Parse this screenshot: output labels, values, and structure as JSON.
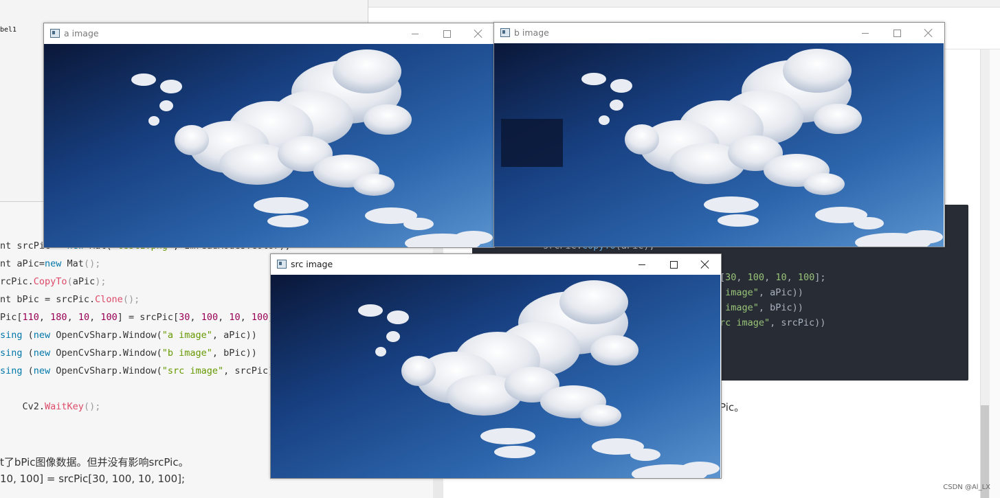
{
  "background": {
    "label_fragment": "bel1",
    "left_code_lines": [
      {
        "id": "l1",
        "text": "nt srcPic = new Mat(\"test1.png\", ImreadModes.Color);"
      },
      {
        "id": "l2",
        "text": "nt aPic=new Mat();"
      },
      {
        "id": "l3",
        "text": "rcPic.CopyTo(aPic);"
      },
      {
        "id": "l4",
        "text": "nt bPic = srcPic.Clone();"
      },
      {
        "id": "l5",
        "text": "Pic[110, 180, 10, 100] = srcPic[30, 100, 10, 100];"
      },
      {
        "id": "l6",
        "text": "sing (new OpenCvSharp.Window(\"a image\", aPic))"
      },
      {
        "id": "l7",
        "text": "sing (new OpenCvSharp.Window(\"b image\", bPic))"
      },
      {
        "id": "l8",
        "text": "sing (new OpenCvSharp.Window(\"src image\", srcPic))"
      },
      {
        "id": "l9",
        "text": "    Cv2.WaitKey();"
      }
    ],
    "left_prose_1": "t了bPic图像数据。但并没有影响srcPic。",
    "left_prose_2": "10, 100] = srcPic[30, 100, 10, 100];",
    "right_code_lines": [
      {
        "id": "r1",
        "text": "srcPic.CopyTo(aPic);"
      },
      {
        "id": "r2",
        "text": "[30, 100, 10, 100];"
      },
      {
        "id": "r3",
        "text": " image\", aPic))"
      },
      {
        "id": "r4",
        "text": " image\", bPic))"
      },
      {
        "id": "r5",
        "text": "rc image\", srcPic))"
      }
    ],
    "right_prose": "Pic。",
    "watermark": "CSDN @Al_LX"
  },
  "windows": [
    {
      "id": "a",
      "title": "a image",
      "active": false
    },
    {
      "id": "b",
      "title": "b image",
      "active": false
    },
    {
      "id": "src",
      "title": "src image",
      "active": true
    }
  ],
  "window_controls": {
    "minimize": "minimize-icon",
    "maximize": "maximize-icon",
    "close": "close-icon"
  },
  "colors": {
    "sky_dark": "#0b1c44",
    "sky_mid": "#1f4f94",
    "sky_light": "#4d88c8",
    "cloud": "#f2f3f6",
    "code_bg_dark": "#282c34"
  }
}
